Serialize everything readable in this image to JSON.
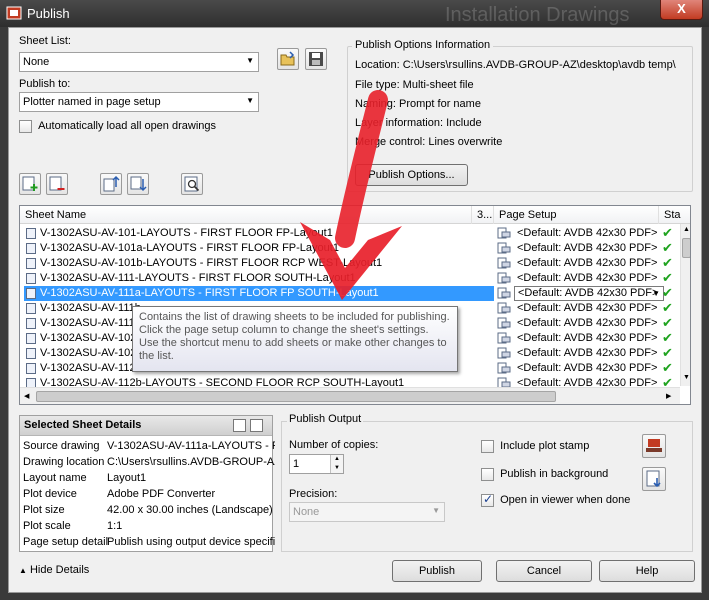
{
  "window": {
    "title": "Publish",
    "background_title": "Installation Drawings",
    "close_label": "X"
  },
  "sheet_list": {
    "label": "Sheet List:",
    "value": "None"
  },
  "publish_to": {
    "label": "Publish to:",
    "value": "Plotter named in page setup"
  },
  "auto_load": {
    "label": "Automatically load all open drawings",
    "checked": false
  },
  "publish_options": {
    "legend": "Publish Options Information",
    "location": "Location:  C:\\Users\\rsullins.AVDB-GROUP-AZ\\desktop\\avdb temp\\",
    "file_type": "File type: Multi-sheet file",
    "naming": "Naming: Prompt for name",
    "layer_info": "Layer information: Include",
    "merge": "Merge control: Lines overwrite",
    "button": "Publish Options..."
  },
  "sheets": {
    "columns": {
      "name": "Sheet Name",
      "num": "3...",
      "page_setup": "Page Setup",
      "status": "Sta"
    },
    "rows": [
      {
        "name": "V-1302ASU-AV-101-LAYOUTS - FIRST FLOOR FP-Layout1",
        "setup": "<Default: AVDB 42x30 PDF>"
      },
      {
        "name": "V-1302ASU-AV-101a-LAYOUTS - FIRST FLOOR FP-Layout1",
        "setup": "<Default: AVDB 42x30 PDF>"
      },
      {
        "name": "V-1302ASU-AV-101b-LAYOUTS - FIRST FLOOR RCP WEST-Layout1",
        "setup": "<Default: AVDB 42x30 PDF>"
      },
      {
        "name": "V-1302ASU-AV-111-LAYOUTS - FIRST FLOOR SOUTH-Layout1",
        "setup": "<Default: AVDB 42x30 PDF>"
      },
      {
        "name": "V-1302ASU-AV-111a-LAYOUTS - FIRST FLOOR FP SOUTH-Layout1",
        "setup": "<Default: AVDB 42x30 PDF>"
      },
      {
        "name": "V-1302ASU-AV-111b",
        "setup": "<Default: AVDB 42x30 PDF>"
      },
      {
        "name": "V-1302ASU-AV-111c",
        "setup": "<Default: AVDB 42x30 PDF>"
      },
      {
        "name": "V-1302ASU-AV-102a",
        "setup": "<Default: AVDB 42x30 PDF>"
      },
      {
        "name": "V-1302ASU-AV-102-L",
        "setup": "<Default: AVDB 42x30 PDF>"
      },
      {
        "name": "V-1302ASU-AV-112a",
        "setup": "<Default: AVDB 42x30 PDF>"
      },
      {
        "name": "V-1302ASU-AV-112b-LAYOUTS - SECOND FLOOR RCP SOUTH-Layout1",
        "setup": "<Default: AVDB 42x30 PDF>"
      }
    ],
    "selected_index": 4,
    "tooltip": "Contains the list of drawing sheets to be included for publishing. Click the page setup column to change the sheet's settings. Use the shortcut menu to add sheets or make other changes to the list."
  },
  "details": {
    "title": "Selected Sheet Details",
    "rows": [
      {
        "k": "Source drawing",
        "v": "V-1302ASU-AV-111a-LAYOUTS - FI..."
      },
      {
        "k": "Drawing location",
        "v": "C:\\Users\\rsullins.AVDB-GROUP-AZ\\..."
      },
      {
        "k": "Layout name",
        "v": "Layout1"
      },
      {
        "k": "Plot device",
        "v": "Adobe PDF Converter"
      },
      {
        "k": "Plot size",
        "v": "42.00 x 30.00 inches (Landscape)"
      },
      {
        "k": "Plot scale",
        "v": "1:1"
      },
      {
        "k": "Page setup detail",
        "v": "Publish using output device specifie..."
      }
    ]
  },
  "output": {
    "legend": "Publish Output",
    "copies_label": "Number of copies:",
    "copies_value": "1",
    "precision_label": "Precision:",
    "precision_value": "None",
    "plot_stamp": {
      "label": "Include plot stamp",
      "checked": false
    },
    "background": {
      "label": "Publish in background",
      "checked": false
    },
    "viewer": {
      "label": "Open in viewer when done",
      "checked": true
    }
  },
  "footer": {
    "hide_details": "Hide Details",
    "publish": "Publish",
    "cancel": "Cancel",
    "help": "Help"
  },
  "colors": {
    "selection": "#3399ff",
    "status_ok": "#1fa31f",
    "annotation_arrow": "#e8202a"
  }
}
